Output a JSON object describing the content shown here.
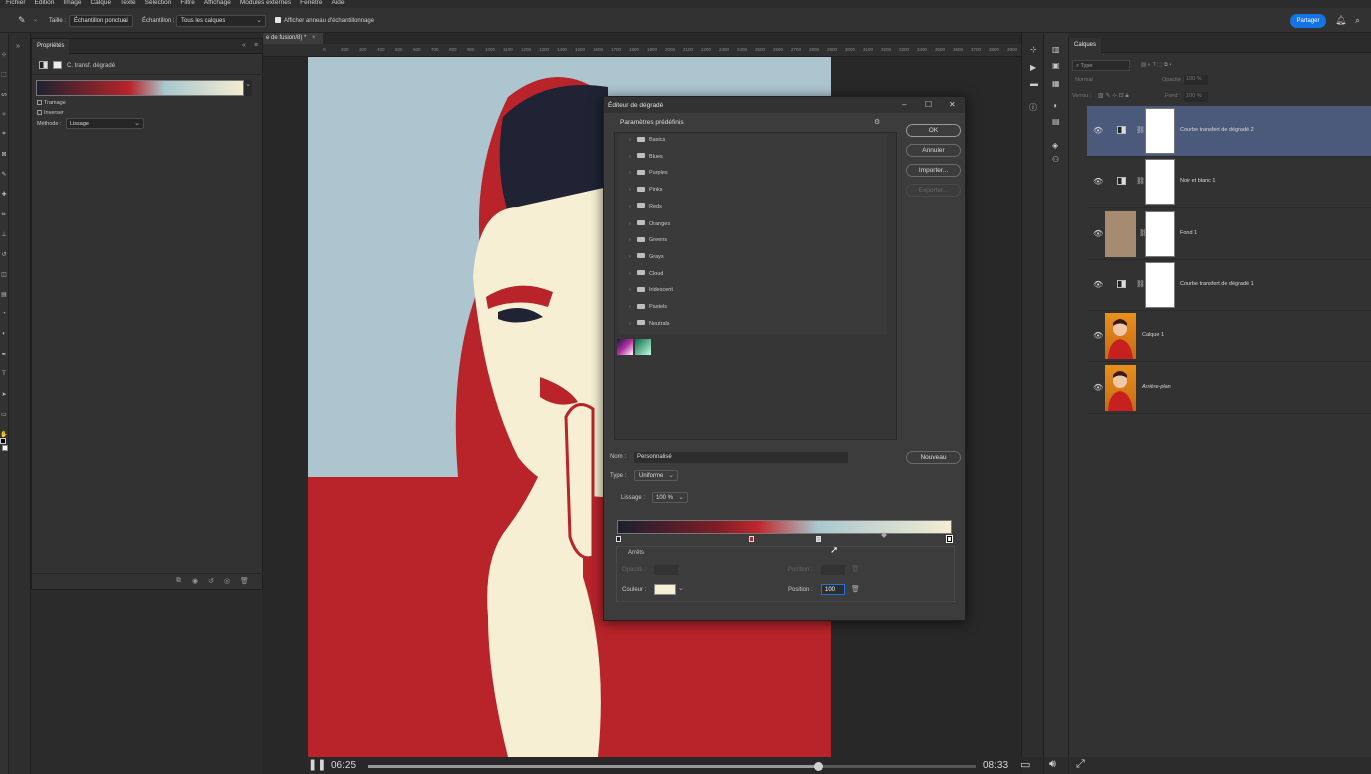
{
  "menu": [
    "Fichier",
    "Édition",
    "Image",
    "Calque",
    "Texte",
    "Sélection",
    "Filtre",
    "Affichage",
    "Modules externes",
    "Fenêtre",
    "Aide"
  ],
  "options_bar": {
    "taille_label": "Taille :",
    "taille_value": "Échantillon ponctuel",
    "echantillon_label": "Échantillon :",
    "echantillon_value": "Tous les calques",
    "show_ring_label": "Afficher anneau d'échantillonnage",
    "share_button": "Partager"
  },
  "properties": {
    "tab_label": "Propriétés",
    "header_label": "C. transf. dégradé",
    "tramage_label": "Tramage",
    "inverser_label": "Inverser",
    "methode_label": "Méthode :",
    "methode_value": "Lissage",
    "gradient_colors": [
      "#1e2230",
      "#b8242a",
      "#a9c8cf",
      "#f4ecd2"
    ]
  },
  "document": {
    "tab_title": "e de fusion/8) *",
    "ruler_ticks": [
      "0",
      "200",
      "300",
      "400",
      "500",
      "600",
      "700",
      "800",
      "900",
      "1000",
      "1100",
      "1200",
      "1300",
      "1400",
      "1500",
      "1600",
      "1700",
      "1800",
      "1900",
      "2000",
      "2100",
      "2200",
      "2300",
      "2400",
      "2500",
      "2600",
      "2700",
      "2800",
      "2900",
      "3000",
      "3100",
      "3200",
      "3300",
      "3400",
      "3500",
      "3600",
      "3700",
      "3800",
      "3900",
      "4000",
      "4100",
      "4200"
    ]
  },
  "dialog": {
    "title": "Éditeur de dégradé",
    "presets_label": "Paramètres prédéfinis",
    "folders": [
      "Basics",
      "Blues",
      "Purples",
      "Pinks",
      "Reds",
      "Oranges",
      "Greens",
      "Grays",
      "Cloud",
      "Iridescent",
      "Pastels",
      "Neutrals"
    ],
    "ok_label": "OK",
    "cancel_label": "Annuler",
    "import_label": "Importer...",
    "export_label": "Exporter...",
    "name_label": "Nom :",
    "name_value": "Personnalisé",
    "new_label": "Nouveau",
    "type_label": "Type :",
    "type_value": "Uniforme",
    "smooth_label": "Lissage :",
    "smooth_value": "100 %",
    "stops_label": "Arrêts",
    "opacity_label": "Opacité :",
    "position_label_top": "Position :",
    "color_label": "Couleur :",
    "position_label": "Position :",
    "position_value": "100",
    "gradient_colors": [
      "#1c1f2e",
      "#7e1e26",
      "#c0262b",
      "#a9c8cf",
      "#f4ecd2"
    ],
    "color_swatch": "#f6efd3"
  },
  "layers": {
    "tab_label": "Calques",
    "search_placeholder": "Type",
    "blend_mode": "Normal",
    "opacity_label": "Opacité :",
    "opacity_value": "100 %",
    "lock_label": "Verrou :",
    "fill_label": "Fond :",
    "fill_value": "100 %",
    "items": [
      {
        "name": "Courbe transfert de dégradé 2",
        "selected": true
      },
      {
        "name": "Noir et blanc 1",
        "selected": false
      },
      {
        "name": "Fond 1",
        "selected": false
      },
      {
        "name": "Courbe transfert de dégradé 1",
        "selected": false
      },
      {
        "name": "Calque 1",
        "selected": false
      },
      {
        "name": "Arrière-plan",
        "selected": false
      }
    ]
  },
  "video": {
    "current_time": "06:25",
    "total_time": "08:33",
    "progress": 0.74
  }
}
